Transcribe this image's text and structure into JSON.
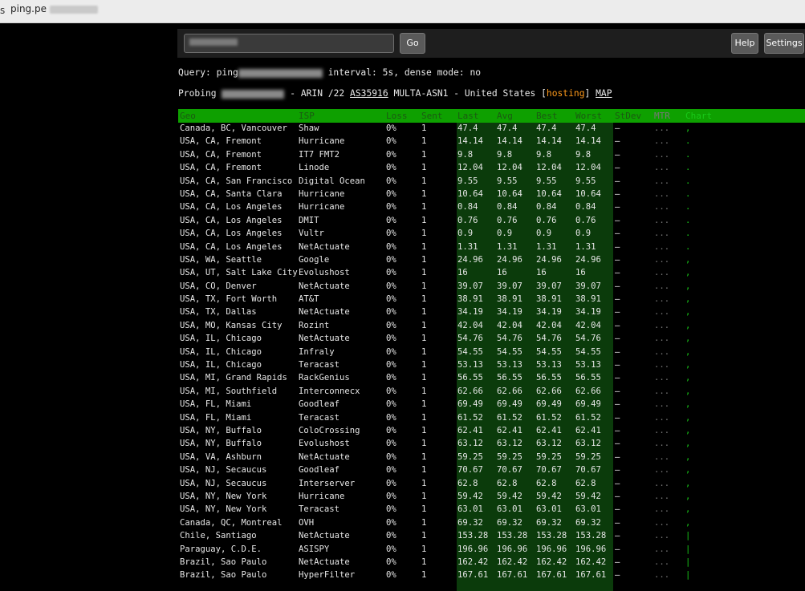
{
  "browser": {
    "edge_glyph": "s",
    "url": "ping.pe"
  },
  "toolbar": {
    "go_label": "Go",
    "help_label": "Help",
    "settings_label": "Settings"
  },
  "query": {
    "prefix": "Query: ping",
    "suffix": " interval: 5s, dense mode: no"
  },
  "probing": {
    "prefix": "Probing ",
    "text1": " - ARIN /22 ",
    "asn": "AS35916",
    "text2": " MULTA-ASN1 - United States [",
    "tag": "hosting",
    "text3": "] ",
    "map": "MAP"
  },
  "table": {
    "headers": [
      "Geo",
      "ISP",
      "Loss",
      "Sent",
      "Last",
      "Avg",
      "Best",
      "Worst",
      "StDev",
      "MTR",
      "Chart"
    ],
    "rows": [
      [
        "Canada, BC, Vancouver",
        "Shaw",
        "0%",
        "1",
        "47.4",
        "47.4",
        "47.4",
        "47.4",
        "–",
        "...",
        ","
      ],
      [
        "USA, CA, Fremont",
        "Hurricane",
        "0%",
        "1",
        "14.14",
        "14.14",
        "14.14",
        "14.14",
        "–",
        "...",
        "."
      ],
      [
        "USA, CA, Fremont",
        "IT7 FMT2",
        "0%",
        "1",
        "9.8",
        "9.8",
        "9.8",
        "9.8",
        "–",
        "...",
        "."
      ],
      [
        "USA, CA, Fremont",
        "Linode",
        "0%",
        "1",
        "12.04",
        "12.04",
        "12.04",
        "12.04",
        "–",
        "...",
        "."
      ],
      [
        "USA, CA, San Francisco",
        "Digital Ocean",
        "0%",
        "1",
        "9.55",
        "9.55",
        "9.55",
        "9.55",
        "–",
        "...",
        "."
      ],
      [
        "USA, CA, Santa Clara",
        "Hurricane",
        "0%",
        "1",
        "10.64",
        "10.64",
        "10.64",
        "10.64",
        "–",
        "...",
        "."
      ],
      [
        "USA, CA, Los Angeles",
        "Hurricane",
        "0%",
        "1",
        "0.84",
        "0.84",
        "0.84",
        "0.84",
        "–",
        "...",
        "."
      ],
      [
        "USA, CA, Los Angeles",
        "DMIT",
        "0%",
        "1",
        "0.76",
        "0.76",
        "0.76",
        "0.76",
        "–",
        "...",
        "."
      ],
      [
        "USA, CA, Los Angeles",
        "Vultr",
        "0%",
        "1",
        "0.9",
        "0.9",
        "0.9",
        "0.9",
        "–",
        "...",
        "."
      ],
      [
        "USA, CA, Los Angeles",
        "NetActuate",
        "0%",
        "1",
        "1.31",
        "1.31",
        "1.31",
        "1.31",
        "–",
        "...",
        "."
      ],
      [
        "USA, WA, Seattle",
        "Google",
        "0%",
        "1",
        "24.96",
        "24.96",
        "24.96",
        "24.96",
        "–",
        "...",
        ","
      ],
      [
        "USA, UT, Salt Lake City",
        "Evolushost",
        "0%",
        "1",
        "16",
        "16",
        "16",
        "16",
        "–",
        "...",
        ","
      ],
      [
        "USA, CO, Denver",
        "NetActuate",
        "0%",
        "1",
        "39.07",
        "39.07",
        "39.07",
        "39.07",
        "–",
        "...",
        ","
      ],
      [
        "USA, TX, Fort Worth",
        "AT&T",
        "0%",
        "1",
        "38.91",
        "38.91",
        "38.91",
        "38.91",
        "–",
        "...",
        ","
      ],
      [
        "USA, TX, Dallas",
        "NetActuate",
        "0%",
        "1",
        "34.19",
        "34.19",
        "34.19",
        "34.19",
        "–",
        "...",
        ","
      ],
      [
        "USA, MO, Kansas City",
        "Rozint",
        "0%",
        "1",
        "42.04",
        "42.04",
        "42.04",
        "42.04",
        "–",
        "...",
        ","
      ],
      [
        "USA, IL, Chicago",
        "NetActuate",
        "0%",
        "1",
        "54.76",
        "54.76",
        "54.76",
        "54.76",
        "–",
        "...",
        ","
      ],
      [
        "USA, IL, Chicago",
        "Infraly",
        "0%",
        "1",
        "54.55",
        "54.55",
        "54.55",
        "54.55",
        "–",
        "...",
        ","
      ],
      [
        "USA, IL, Chicago",
        "Teracast",
        "0%",
        "1",
        "53.13",
        "53.13",
        "53.13",
        "53.13",
        "–",
        "...",
        ","
      ],
      [
        "USA, MI, Grand Rapids",
        "RackGenius",
        "0%",
        "1",
        "56.55",
        "56.55",
        "56.55",
        "56.55",
        "–",
        "...",
        ","
      ],
      [
        "USA, MI, Southfield",
        "Interconnecx",
        "0%",
        "1",
        "62.66",
        "62.66",
        "62.66",
        "62.66",
        "–",
        "...",
        ","
      ],
      [
        "USA, FL, Miami",
        "Goodleaf",
        "0%",
        "1",
        "69.49",
        "69.49",
        "69.49",
        "69.49",
        "–",
        "...",
        ","
      ],
      [
        "USA, FL, Miami",
        "Teracast",
        "0%",
        "1",
        "61.52",
        "61.52",
        "61.52",
        "61.52",
        "–",
        "...",
        ","
      ],
      [
        "USA, NY, Buffalo",
        "ColoCrossing",
        "0%",
        "1",
        "62.41",
        "62.41",
        "62.41",
        "62.41",
        "–",
        "...",
        ","
      ],
      [
        "USA, NY, Buffalo",
        "Evolushost",
        "0%",
        "1",
        "63.12",
        "63.12",
        "63.12",
        "63.12",
        "–",
        "...",
        ","
      ],
      [
        "USA, VA, Ashburn",
        "NetActuate",
        "0%",
        "1",
        "59.25",
        "59.25",
        "59.25",
        "59.25",
        "–",
        "...",
        ","
      ],
      [
        "USA, NJ, Secaucus",
        "Goodleaf",
        "0%",
        "1",
        "70.67",
        "70.67",
        "70.67",
        "70.67",
        "–",
        "...",
        ","
      ],
      [
        "USA, NJ, Secaucus",
        "Interserver",
        "0%",
        "1",
        "62.8",
        "62.8",
        "62.8",
        "62.8",
        "–",
        "...",
        ","
      ],
      [
        "USA, NY, New York",
        "Hurricane",
        "0%",
        "1",
        "59.42",
        "59.42",
        "59.42",
        "59.42",
        "–",
        "...",
        ","
      ],
      [
        "USA, NY, New York",
        "Teracast",
        "0%",
        "1",
        "63.01",
        "63.01",
        "63.01",
        "63.01",
        "–",
        "...",
        ","
      ],
      [
        "Canada, QC, Montreal",
        "OVH",
        "0%",
        "1",
        "69.32",
        "69.32",
        "69.32",
        "69.32",
        "–",
        "...",
        ","
      ],
      [
        "Chile, Santiago",
        "NetActuate",
        "0%",
        "1",
        "153.28",
        "153.28",
        "153.28",
        "153.28",
        "–",
        "...",
        "|"
      ],
      [
        "Paraguay, C.D.E.",
        "ASISPY",
        "0%",
        "1",
        "196.96",
        "196.96",
        "196.96",
        "196.96",
        "–",
        "...",
        "|"
      ],
      [
        "Brazil, Sao Paulo",
        "NetActuate",
        "0%",
        "1",
        "162.42",
        "162.42",
        "162.42",
        "162.42",
        "–",
        "...",
        "|"
      ],
      [
        "Brazil, Sao Paulo",
        "HyperFilter",
        "0%",
        "1",
        "167.61",
        "167.61",
        "167.61",
        "167.61",
        "–",
        "...",
        "|"
      ]
    ]
  },
  "colors": {
    "header_green": "#0ea000",
    "value_band": "#0b3b0b",
    "hosting_tag": "#ff9a1a"
  }
}
